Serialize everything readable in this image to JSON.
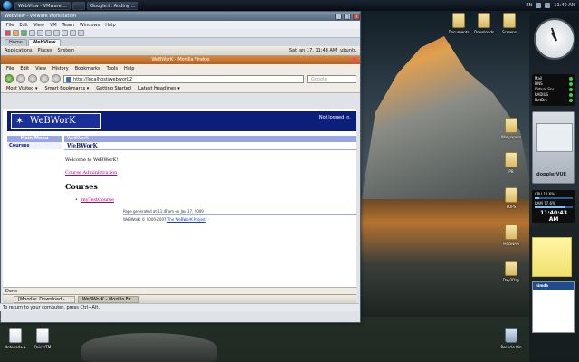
{
  "taskbar": {
    "items": [
      "WebView - VMware ...",
      "",
      "Google.fi: Adding ..."
    ],
    "tray_text": "EN",
    "clock": "11:40 AM"
  },
  "vmware": {
    "title": "WebView - VMware Workstation",
    "menu": [
      "File",
      "Edit",
      "View",
      "VM",
      "Team",
      "Windows",
      "Help"
    ],
    "tabs": [
      "Home",
      "WebView"
    ],
    "status": "To return to your computer, press Ctrl+Alt."
  },
  "guest_panel": {
    "menus": [
      "Applications",
      "Places",
      "System"
    ],
    "datetime": "Sat Jan 17, 11:48 AM",
    "user": "ubuntu"
  },
  "firefox": {
    "title": "WeBWorK - Mozilla Firefox",
    "menu": [
      "File",
      "Edit",
      "View",
      "History",
      "Bookmarks",
      "Tools",
      "Help"
    ],
    "url": "http://localhost/webwork2",
    "search_placeholder": "Google",
    "bookmarks": [
      "Most Visited ▾",
      "Smart Bookmarks ▾",
      "Getting Started",
      "Latest Headlines ▾"
    ],
    "status": "Done"
  },
  "webwork": {
    "logo": "WeBWorK",
    "login_status": "Not logged in.",
    "main_menu": "Main Menu",
    "menu_item": "Courses",
    "top_bar": "WeBWorK",
    "subtitle": "WeBWorK",
    "welcome": "Welcome to WeBWorK!",
    "admin_link": "Course Administration",
    "courses_heading": "Courses",
    "course_link": "myTestCourse",
    "generated": "Page generated at 11:47am on Jan 17, 2009",
    "copyright": "WeBWorK © 2000-2007 ",
    "project_link": "The WeBWorK Project"
  },
  "guest_taskbar": {
    "items": [
      "[Moodle: Download - ...",
      "WeBWorK - Mozilla Fir..."
    ]
  },
  "desktop_icons": [
    {
      "label": "Notepad++",
      "kind": "doc"
    },
    {
      "label": "Quick/TM",
      "kind": "doc"
    },
    {
      "label": "Recycle Bin",
      "kind": "bin"
    },
    {
      "label": "Documents",
      "kind": "folder"
    },
    {
      "label": "Downloads",
      "kind": "folder"
    },
    {
      "label": "Screens",
      "kind": "folder"
    },
    {
      "label": "Wallpapers",
      "kind": "folder"
    },
    {
      "label": "PB",
      "kind": "folder"
    },
    {
      "label": "POPS",
      "kind": "folder"
    },
    {
      "label": "MSDNAA",
      "kind": "folder"
    },
    {
      "label": "Day2Day",
      "kind": "folder"
    }
  ],
  "gadgets": {
    "services": [
      "Mail",
      "DNS",
      "Virtual Srv",
      "RADIUS",
      "NetDrv"
    ],
    "weather_label": "dopplerVUE",
    "cpu": "CPU 12.6%",
    "ram": "RAM 77.6%",
    "time": "11:40:43 AM",
    "cal_header": "nimda"
  }
}
